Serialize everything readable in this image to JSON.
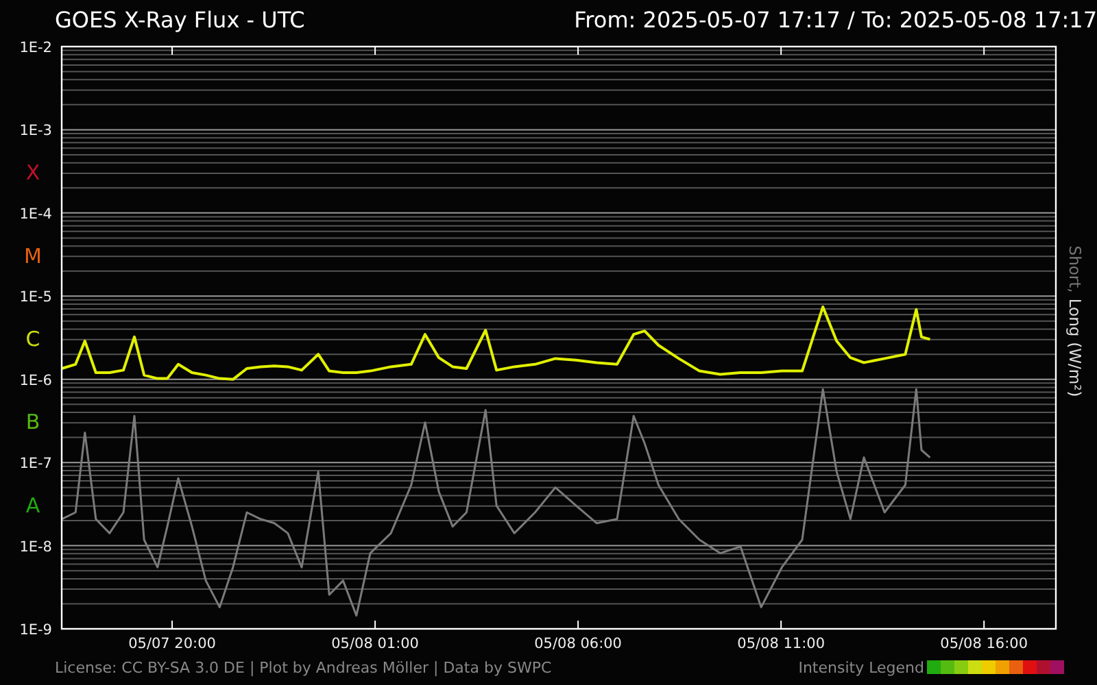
{
  "header": {
    "title": "GOES X-Ray Flux - UTC",
    "range": "From: 2025-05-07 17:17  /  To: 2025-05-08 17:17"
  },
  "flux_plot": {
    "flare_classes": [
      {
        "label": "X",
        "color": "#c0102a"
      },
      {
        "label": "M",
        "color": "#e86010"
      },
      {
        "label": "C",
        "color": "#ccdd11"
      },
      {
        "label": "B",
        "color": "#55bb11"
      },
      {
        "label": "A",
        "color": "#22aa11"
      }
    ],
    "y_ticks": [
      "1E-2",
      "1E-3",
      "1E-4",
      "1E-5",
      "1E-6",
      "1E-7",
      "1E-8",
      "1E-9"
    ],
    "x_ticks": [
      "05/07 20:00",
      "05/08 01:00",
      "05/08 06:00",
      "05/08 11:00",
      "05/08 16:00"
    ],
    "traces": [
      {
        "name": "Short",
        "color": "#7a7a7a"
      },
      {
        "name": "Long",
        "color": "#e0f000"
      }
    ],
    "label_separator": ",",
    "unit": "(W/m²)"
  },
  "footer": {
    "credits": "License: CC BY-SA 3.0 DE | Plot by Andreas Möller | Data by SWPC",
    "legend_label": "Intensity Legend",
    "legend_colors": [
      {
        "color": "#22aa11"
      },
      {
        "color": "#55bb11"
      },
      {
        "color": "#88cc11"
      },
      {
        "color": "#ccdd11"
      },
      {
        "color": "#eecc00"
      },
      {
        "color": "#f0a000"
      },
      {
        "color": "#e86010"
      },
      {
        "color": "#e01010"
      },
      {
        "color": "#b01030"
      },
      {
        "color": "#a01060"
      }
    ]
  }
}
